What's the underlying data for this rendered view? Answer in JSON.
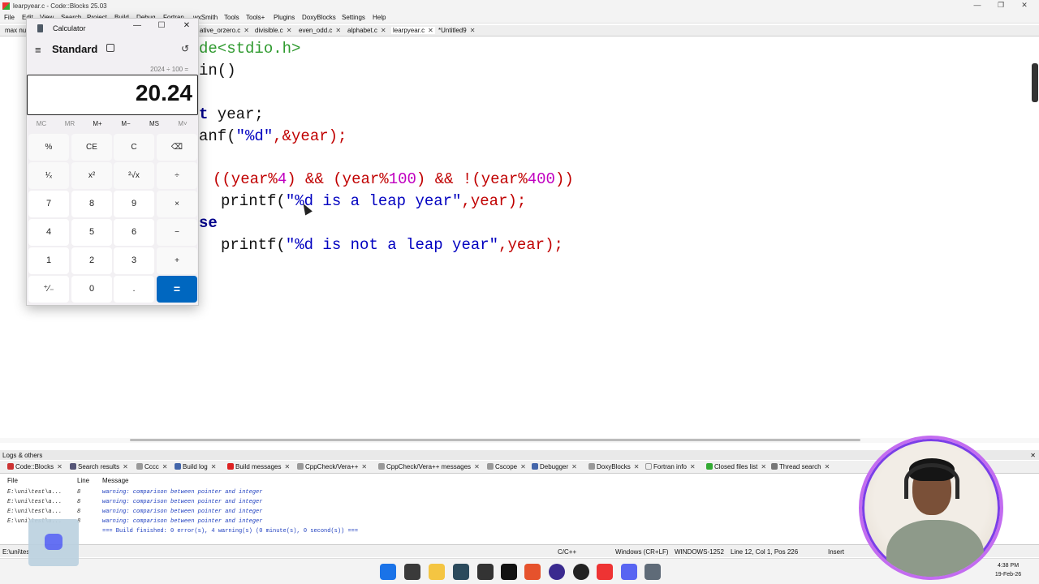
{
  "window": {
    "title": "learpyear.c - Code::Blocks 25.03",
    "controls": [
      "—",
      "❐",
      "✕"
    ]
  },
  "menu": [
    "File",
    "Edit",
    "View",
    "Search",
    "Project",
    "Build",
    "Debug",
    "Fortran",
    "wxSmith",
    "Tools",
    "Tools+",
    "Plugins",
    "DoxyBlocks",
    "Settings",
    "Help"
  ],
  "tabs": [
    "max nu...",
    "ative_orzero.c",
    "divisible.c",
    "even_odd.c",
    "alphabet.c",
    "learpyear.c",
    "*Untitled9"
  ],
  "code": {
    "l1": "de<stdio.h>",
    "l2": "in()",
    "l3_kw": "t",
    "l3_rest": " year;",
    "l4a": "anf(",
    "l4_str": "\"%d\"",
    "l4b": ",&year);",
    "l5_a": "((year",
    "l5_op1": "%",
    "l5_n1": "4",
    "l5_b": ") ",
    "l5_and1": "&&",
    "l5_c": " (year",
    "l5_op2": "%",
    "l5_n2": "100",
    "l5_d": ") ",
    "l5_and2": "&& !",
    "l5_e": "(year",
    "l5_op3": "%",
    "l5_n3": "400",
    "l5_f": "))",
    "l6a": "printf(",
    "l6_str": "\"%d is a leap year\"",
    "l6b": ",year);",
    "l7_kw": "se",
    "l8a": "printf(",
    "l8_str": "\"%d is not a leap year\"",
    "l8b": ",year);"
  },
  "logs": {
    "title": "Logs & others",
    "close": "✕",
    "tabs": [
      "Code::Blocks",
      "Search results",
      "Cccc",
      "Build log",
      "Build messages",
      "CppCheck/Vera++",
      "CppCheck/Vera++ messages",
      "Cscope",
      "Debugger",
      "DoxyBlocks",
      "Fortran info",
      "Closed files list",
      "Thread search"
    ],
    "headers": {
      "file": "File",
      "line": "Line",
      "message": "Message"
    },
    "rows": [
      {
        "file": "E:\\uni\\test\\a...",
        "line": "8",
        "message": "warning: comparison between pointer and integer"
      },
      {
        "file": "E:\\uni\\test\\a...",
        "line": "8",
        "message": "warning: comparison between pointer and integer"
      },
      {
        "file": "E:\\uni\\test\\a...",
        "line": "8",
        "message": "warning: comparison between pointer and integer"
      },
      {
        "file": "E:\\uni\\test\\a...",
        "line": "8",
        "message": "warning: comparison between pointer and integer"
      },
      {
        "file": "",
        "line": "",
        "message": "=== Build finished: 0 error(s), 4 warning(s) (0 minute(s), 0 second(s)) ==="
      }
    ]
  },
  "status": {
    "path": "E:\\uni\\tes",
    "lang": "C/C++",
    "eol": "Windows (CR+LF)",
    "encoding": "WINDOWS-1252",
    "position": "Line 12, Col 1, Pos 226",
    "mode": "Insert"
  },
  "calculator": {
    "title": "Calculator",
    "mode": "Standard",
    "expression": "2024 ÷ 100 =",
    "display": "20.24",
    "memory": [
      "MC",
      "MR",
      "M+",
      "M−",
      "MS",
      "M˅"
    ],
    "keys": [
      [
        "%",
        "CE",
        "C",
        "⌫"
      ],
      [
        "¹⁄ₓ",
        "x²",
        "²√x",
        "÷"
      ],
      [
        "7",
        "8",
        "9",
        "×"
      ],
      [
        "4",
        "5",
        "6",
        "−"
      ],
      [
        "1",
        "2",
        "3",
        "+"
      ],
      [
        "⁺∕₋",
        "0",
        ".",
        "="
      ]
    ],
    "controls": [
      "—",
      "☐",
      "✕"
    ]
  },
  "taskbar": {
    "time": "4:38 PM",
    "date": "19-Feb-26"
  }
}
